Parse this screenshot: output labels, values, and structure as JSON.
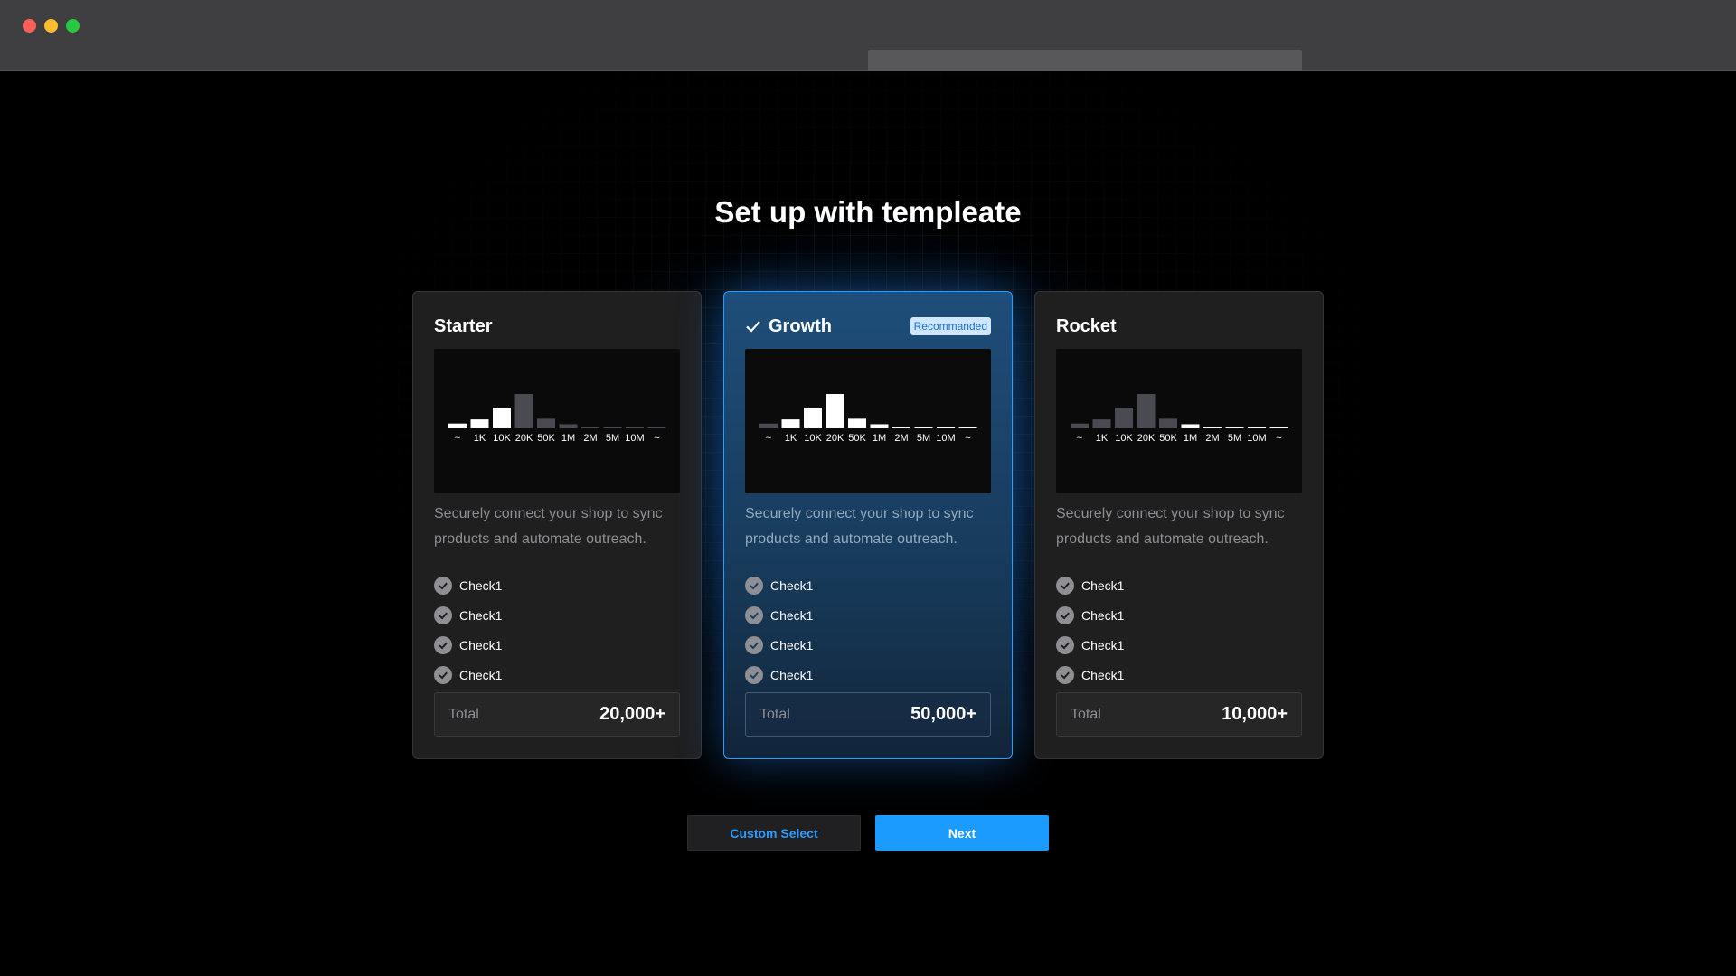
{
  "page": {
    "title": "Set up with templeate"
  },
  "axis_labels": [
    "~",
    "1K",
    "10K",
    "20K",
    "50K",
    "1M",
    "2M",
    "5M",
    "10M",
    "~"
  ],
  "cards": [
    {
      "name": "Starter",
      "selected": false,
      "badge": "",
      "description": "Securely connect your shop to sync products and automate outreach.",
      "checks": [
        "Check1",
        "Check1",
        "Check1",
        "Check1"
      ],
      "total_label": "Total",
      "total_value": "20,000+",
      "bar_levels": [
        0.14,
        0.26,
        0.6,
        1.0,
        0.28,
        0.12,
        0.04,
        0.03,
        0.03,
        0.03
      ],
      "bar_highlight": [
        true,
        true,
        true,
        false,
        false,
        false,
        false,
        false,
        false,
        false
      ]
    },
    {
      "name": "Growth",
      "selected": true,
      "badge": "Recommanded",
      "description": "Securely connect your shop to sync products and automate outreach.",
      "checks": [
        "Check1",
        "Check1",
        "Check1",
        "Check1"
      ],
      "total_label": "Total",
      "total_value": "50,000+",
      "bar_levels": [
        0.14,
        0.26,
        0.6,
        1.0,
        0.28,
        0.12,
        0.04,
        0.03,
        0.03,
        0.03
      ],
      "bar_highlight": [
        false,
        true,
        true,
        true,
        true,
        true,
        true,
        true,
        true,
        true
      ]
    },
    {
      "name": "Rocket",
      "selected": false,
      "badge": "",
      "description": "Securely connect your shop to sync products and automate outreach.",
      "checks": [
        "Check1",
        "Check1",
        "Check1",
        "Check1"
      ],
      "total_label": "Total",
      "total_value": "10,000+",
      "bar_levels": [
        0.14,
        0.26,
        0.6,
        1.0,
        0.28,
        0.12,
        0.04,
        0.03,
        0.03,
        0.03
      ],
      "bar_highlight": [
        false,
        false,
        false,
        false,
        false,
        true,
        true,
        true,
        true,
        true
      ]
    }
  ],
  "buttons": {
    "custom_select": "Custom Select",
    "next": "Next"
  },
  "colors": {
    "accent": "#1c9bff",
    "bar_on": "#ffffff",
    "bar_off": "#4a4a52"
  }
}
